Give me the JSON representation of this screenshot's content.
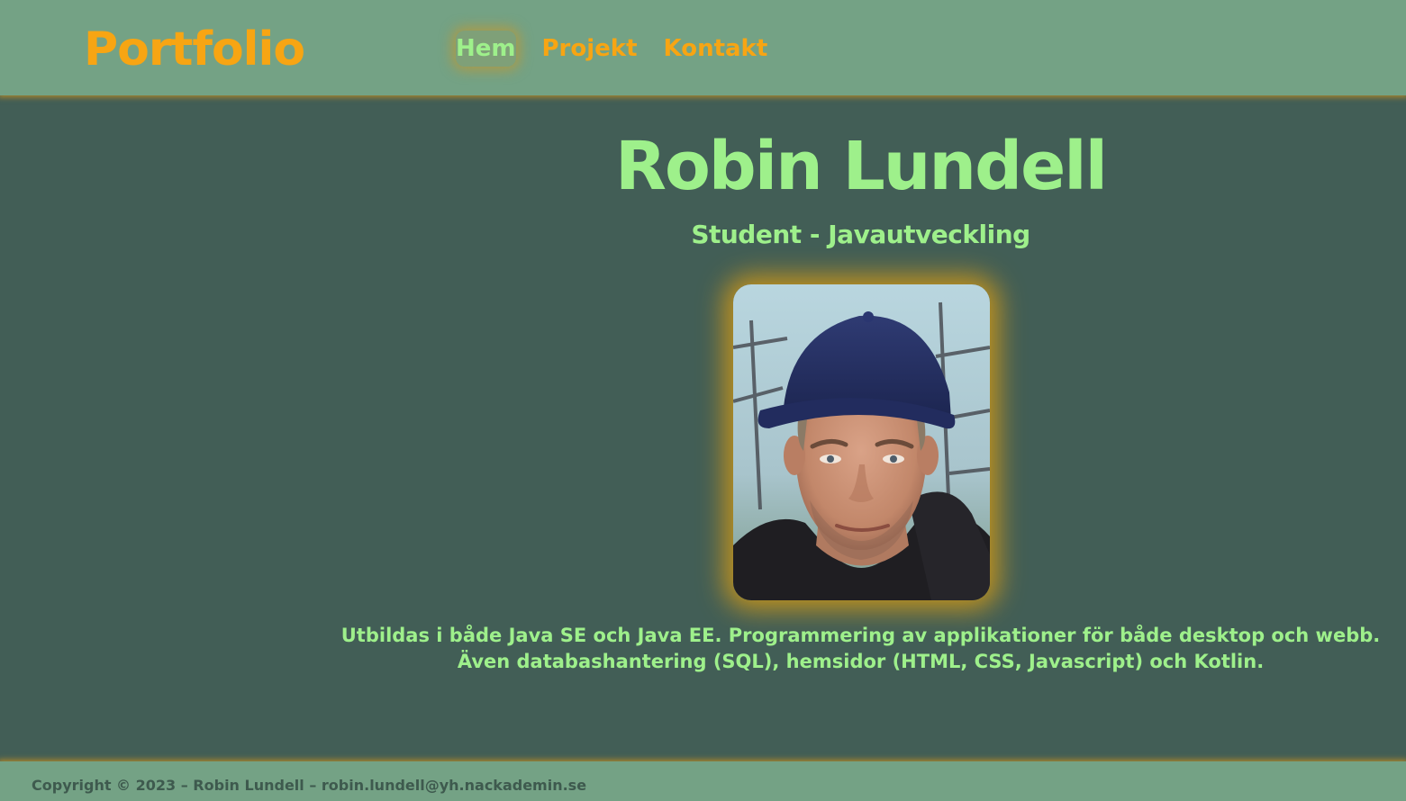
{
  "header": {
    "logo": "Portfolio",
    "nav": [
      {
        "label": "Hem",
        "active": true
      },
      {
        "label": "Projekt",
        "active": false
      },
      {
        "label": "Kontakt",
        "active": false
      }
    ]
  },
  "hero": {
    "name": "Robin Lundell",
    "role": "Student - Javautveckling",
    "bio_lines": [
      "Utbildas i både Java SE och Java EE. Programmering av applikationer för både desktop och webb.",
      "Även databashantering (SQL), hemsidor (HTML, CSS, Javascript) och Kotlin."
    ]
  },
  "footer": {
    "copyright": "Copyright © 2023 – Robin Lundell – robin.lundell@yh.nackademin.se"
  },
  "colors": {
    "header_bg": "#74a285",
    "page_bg": "#425e56",
    "accent_orange": "#f7a513",
    "accent_green": "#9ef08b"
  }
}
